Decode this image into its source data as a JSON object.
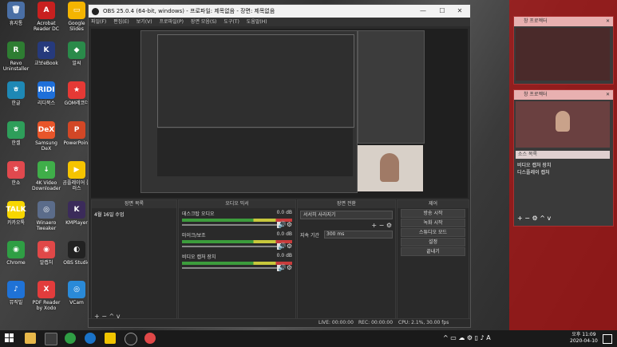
{
  "desktop_icons": [
    {
      "label": "휴지통",
      "color": "#4a6fa5",
      "glyph": "🗑"
    },
    {
      "label": "Acrobat Reader DC",
      "color": "#c8201f",
      "glyph": "A"
    },
    {
      "label": "Google Slides",
      "color": "#f4b400",
      "glyph": "▭"
    },
    {
      "label": "Revo Uninstaller",
      "color": "#2e7d32",
      "glyph": "R"
    },
    {
      "label": "교보eBook",
      "color": "#263a7c",
      "glyph": "K"
    },
    {
      "label": "알씨",
      "color": "#2a8a4a",
      "glyph": "◆"
    },
    {
      "label": "한글",
      "color": "#1e88b5",
      "glyph": "ㅎ"
    },
    {
      "label": "리디북스",
      "color": "#1e6fd9",
      "glyph": "RIDI"
    },
    {
      "label": "GOM레코더",
      "color": "#e53935",
      "glyph": "★"
    },
    {
      "label": "한셀",
      "color": "#2e9e5a",
      "glyph": "ㅎ"
    },
    {
      "label": "Samsung DeX",
      "color": "#e8552a",
      "glyph": "DeX"
    },
    {
      "label": "PowerPoint",
      "color": "#d24726",
      "glyph": "P"
    },
    {
      "label": "한쇼",
      "color": "#e0494e",
      "glyph": "ㅎ"
    },
    {
      "label": "4K Video Downloader",
      "color": "#3fae49",
      "glyph": "↓"
    },
    {
      "label": "곰플레이어 플러스",
      "color": "#f5c400",
      "glyph": "▶"
    },
    {
      "label": "카카오톡",
      "color": "#f7d600",
      "glyph": "TALK"
    },
    {
      "label": "Winaero Tweaker",
      "color": "#5b6c8a",
      "glyph": "◎"
    },
    {
      "label": "KMPlayer",
      "color": "#3b2b5a",
      "glyph": "K"
    },
    {
      "label": "Chrome",
      "color": "#2f9e44",
      "glyph": "◉"
    },
    {
      "label": "알캡처",
      "color": "#e04848",
      "glyph": "◉"
    },
    {
      "label": "OBS Studio",
      "color": "#222222",
      "glyph": "◐"
    },
    {
      "label": "뮤직빌",
      "color": "#1f72d6",
      "glyph": "♪"
    },
    {
      "label": "PDF Reader by Xodo",
      "color": "#e23c3c",
      "glyph": "X"
    },
    {
      "label": "VCam",
      "color": "#2a8ad8",
      "glyph": "◎"
    }
  ],
  "obs": {
    "title": "OBS 25.0.4 (64-bit, windows) - 프로파일: 제목없음 - 장면: 제목없음",
    "menu": [
      "파일(F)",
      "편집(E)",
      "보기(V)",
      "프로파일(P)",
      "장면 모음(S)",
      "도구(T)",
      "도움말(H)"
    ],
    "scenes_panel": {
      "title": "장면 목록",
      "items": [
        "4월 16일 수업"
      ]
    },
    "mixer_panel": {
      "title": "오디오 믹서",
      "channels": [
        {
          "name": "데스크탑 오디오",
          "db": "0.0 dB"
        },
        {
          "name": "마이크/보조",
          "db": "0.0 dB"
        },
        {
          "name": "비디오 캡처 장치",
          "db": "0.0 dB"
        }
      ]
    },
    "transition_panel": {
      "title": "장면 전환",
      "type": "서서히 사라지기",
      "duration_label": "지속 기간",
      "duration": "300 ms"
    },
    "controls_panel": {
      "title": "제어",
      "buttons": [
        "방송 시작",
        "녹화 시작",
        "스튜디오 모드",
        "설정",
        "끝내기"
      ]
    },
    "status": {
      "live": "LIVE: 00:00:00",
      "rec": "REC: 00:00:00",
      "cpu": "CPU: 2.1%, 30.00 fps"
    }
  },
  "side_windows": [
    {
      "title": "창 프로젝터"
    },
    {
      "title": "창 프로젝터",
      "sources_title": "소스 목록",
      "sources": [
        "비디오 캡처 장치",
        "디스플레이 캡처"
      ]
    }
  ],
  "taskbar": {
    "time": "오후 11:09",
    "date": "2020-04-10"
  }
}
